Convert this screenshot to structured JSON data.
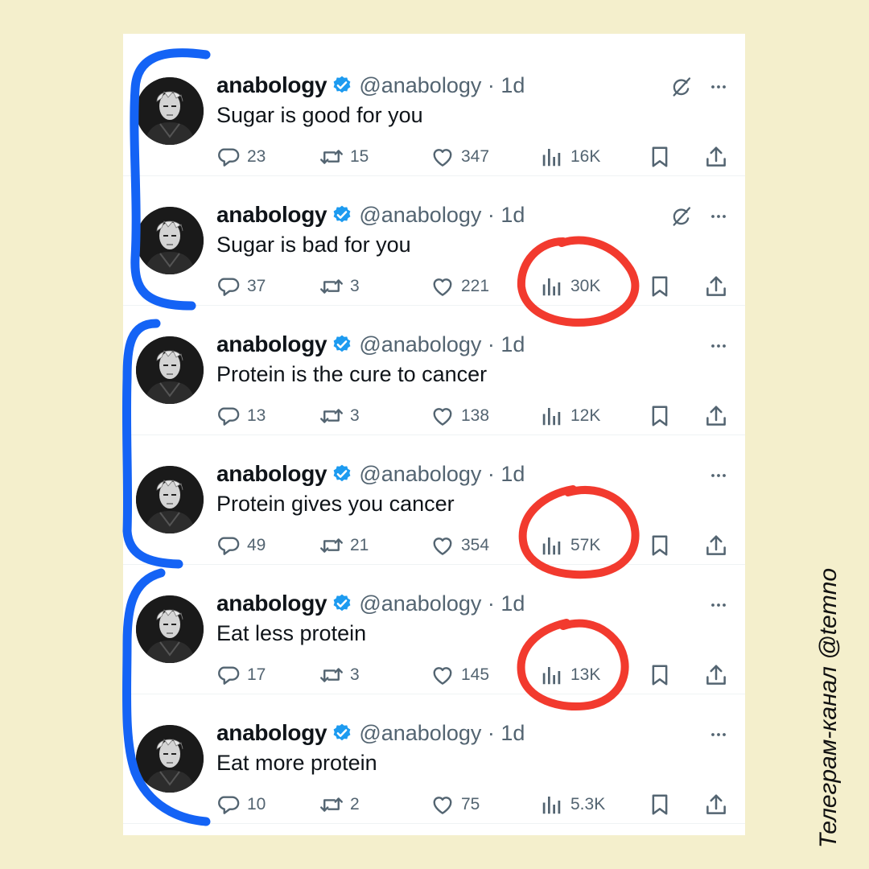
{
  "caption": "Телеграм-канал @temno",
  "tweets": [
    {
      "name": "anabology",
      "handle": "@anabology · 1d",
      "text": "Sugar is good for you",
      "replies": "23",
      "retweets": "15",
      "likes": "347",
      "views": "16K",
      "grok": true
    },
    {
      "name": "anabology",
      "handle": "@anabology · 1d",
      "text": "Sugar is bad for you",
      "replies": "37",
      "retweets": "3",
      "likes": "221",
      "views": "30K",
      "grok": true
    },
    {
      "name": "anabology",
      "handle": "@anabology · 1d",
      "text": "Protein is the cure to cancer",
      "replies": "13",
      "retweets": "3",
      "likes": "138",
      "views": "12K",
      "grok": false
    },
    {
      "name": "anabology",
      "handle": "@anabology · 1d",
      "text": "Protein gives you cancer",
      "replies": "49",
      "retweets": "21",
      "likes": "354",
      "views": "57K",
      "grok": false
    },
    {
      "name": "anabology",
      "handle": "@anabology · 1d",
      "text": "Eat less protein",
      "replies": "17",
      "retweets": "3",
      "likes": "145",
      "views": "13K",
      "grok": false
    },
    {
      "name": "anabology",
      "handle": "@anabology · 1d",
      "text": "Eat more protein",
      "replies": "10",
      "retweets": "2",
      "likes": "75",
      "views": "5.3K",
      "grok": false
    }
  ],
  "colors": {
    "background": "#f4efcc",
    "verified": "#1d9bf0",
    "bracket": "#1463f5",
    "highlight": "#f23a2e",
    "icon_gray": "#536471"
  },
  "icons": [
    "verified-badge-icon",
    "grok-icon",
    "more-icon",
    "reply-icon",
    "retweet-icon",
    "like-icon",
    "views-icon",
    "bookmark-icon",
    "share-icon"
  ]
}
